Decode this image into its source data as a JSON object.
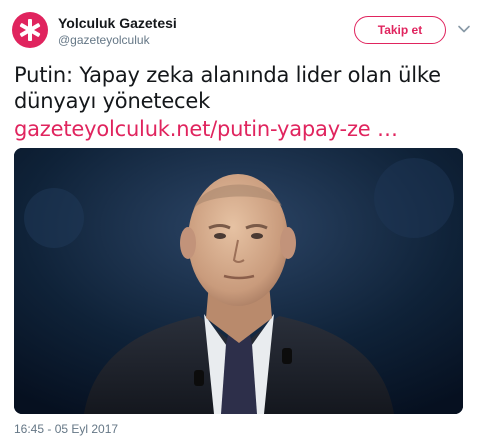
{
  "author": {
    "display_name": "Yolculuk Gazetesi",
    "handle": "@gazeteyolculuk",
    "avatar_icon": "asterisk-logo-icon",
    "avatar_color": "#e0245e"
  },
  "actions": {
    "follow_label": "Takip et",
    "menu_icon": "chevron-down-icon"
  },
  "tweet": {
    "text_line1": "Putin: Yapay zeka alanında lider olan ülke",
    "text_line2": "dünyayı yönetecek",
    "link": "gazeteyolculuk.net/putin-yapay-ze  …",
    "media_alt": "photo-of-man-in-suit"
  },
  "meta": {
    "timestamp": "16:45 - 05 Eyl 2017"
  },
  "colors": {
    "accent": "#e0245e",
    "secondary_text": "#657786"
  }
}
